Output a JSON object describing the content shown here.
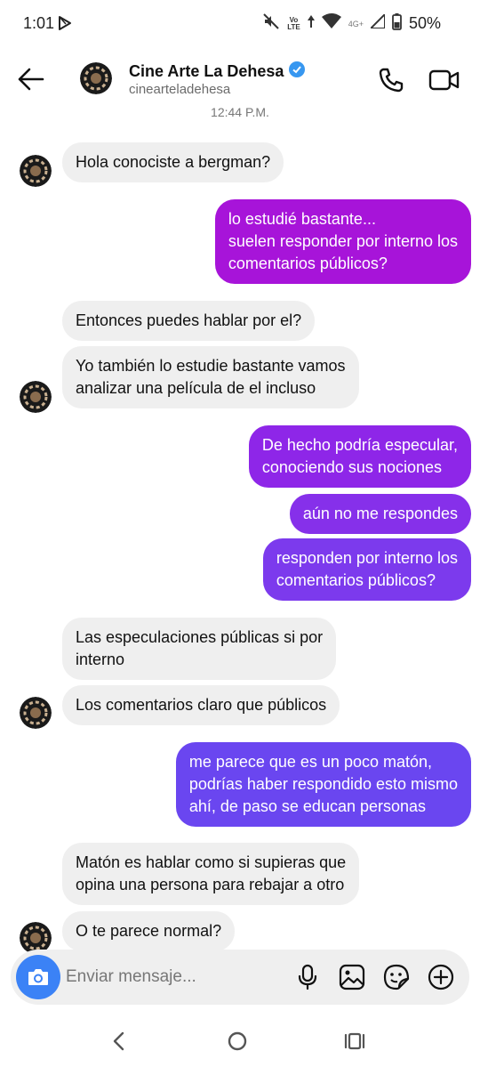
{
  "status_bar": {
    "time": "1:01",
    "network_label": "Vo\nLTE",
    "network_4g": "4G+",
    "battery": "50%"
  },
  "header": {
    "name": "Cine Arte La Dehesa",
    "handle": "cinearteladehesa",
    "verified_color": "#3797f0"
  },
  "conversation": {
    "timestamp": "12:44 P.M.",
    "messages": [
      {
        "from": "them",
        "text": "Hola conociste a bergman?"
      },
      {
        "from": "me",
        "text": "lo estudié bastante...\nsuelen responder por interno los\ncomentarios públicos?"
      },
      {
        "from": "them",
        "text": "Entonces puedes hablar por el?"
      },
      {
        "from": "them",
        "text": "Yo también lo estudie bastante vamos\nanalizar una película de el incluso"
      },
      {
        "from": "me",
        "text": "De hecho podría especular,\nconociendo sus nociones"
      },
      {
        "from": "me",
        "text": "aún no me respondes"
      },
      {
        "from": "me",
        "text": "responden por interno los\ncomentarios públicos?"
      },
      {
        "from": "them",
        "text": "Las especulaciones públicas si por\ninterno"
      },
      {
        "from": "them",
        "text": "Los comentarios claro que públicos"
      },
      {
        "from": "me",
        "text": "me parece que es un poco matón,\npodrías haber respondido esto mismo\nahí, de paso se educan personas"
      },
      {
        "from": "them",
        "text": "Matón es hablar como si supieras que\nopina una persona para rebajar a otro"
      },
      {
        "from": "them",
        "text": "O te parece normal?"
      }
    ]
  },
  "composer": {
    "placeholder": "Enviar mensaje...",
    "camera_color": "#3b82f6"
  },
  "icons": [
    "back-arrow-icon",
    "verified-badge-icon",
    "phone-icon",
    "video-camera-icon",
    "camera-icon",
    "microphone-icon",
    "image-icon",
    "sticker-icon",
    "plus-circle-icon",
    "nav-back-icon",
    "nav-home-icon",
    "nav-recents-icon"
  ]
}
